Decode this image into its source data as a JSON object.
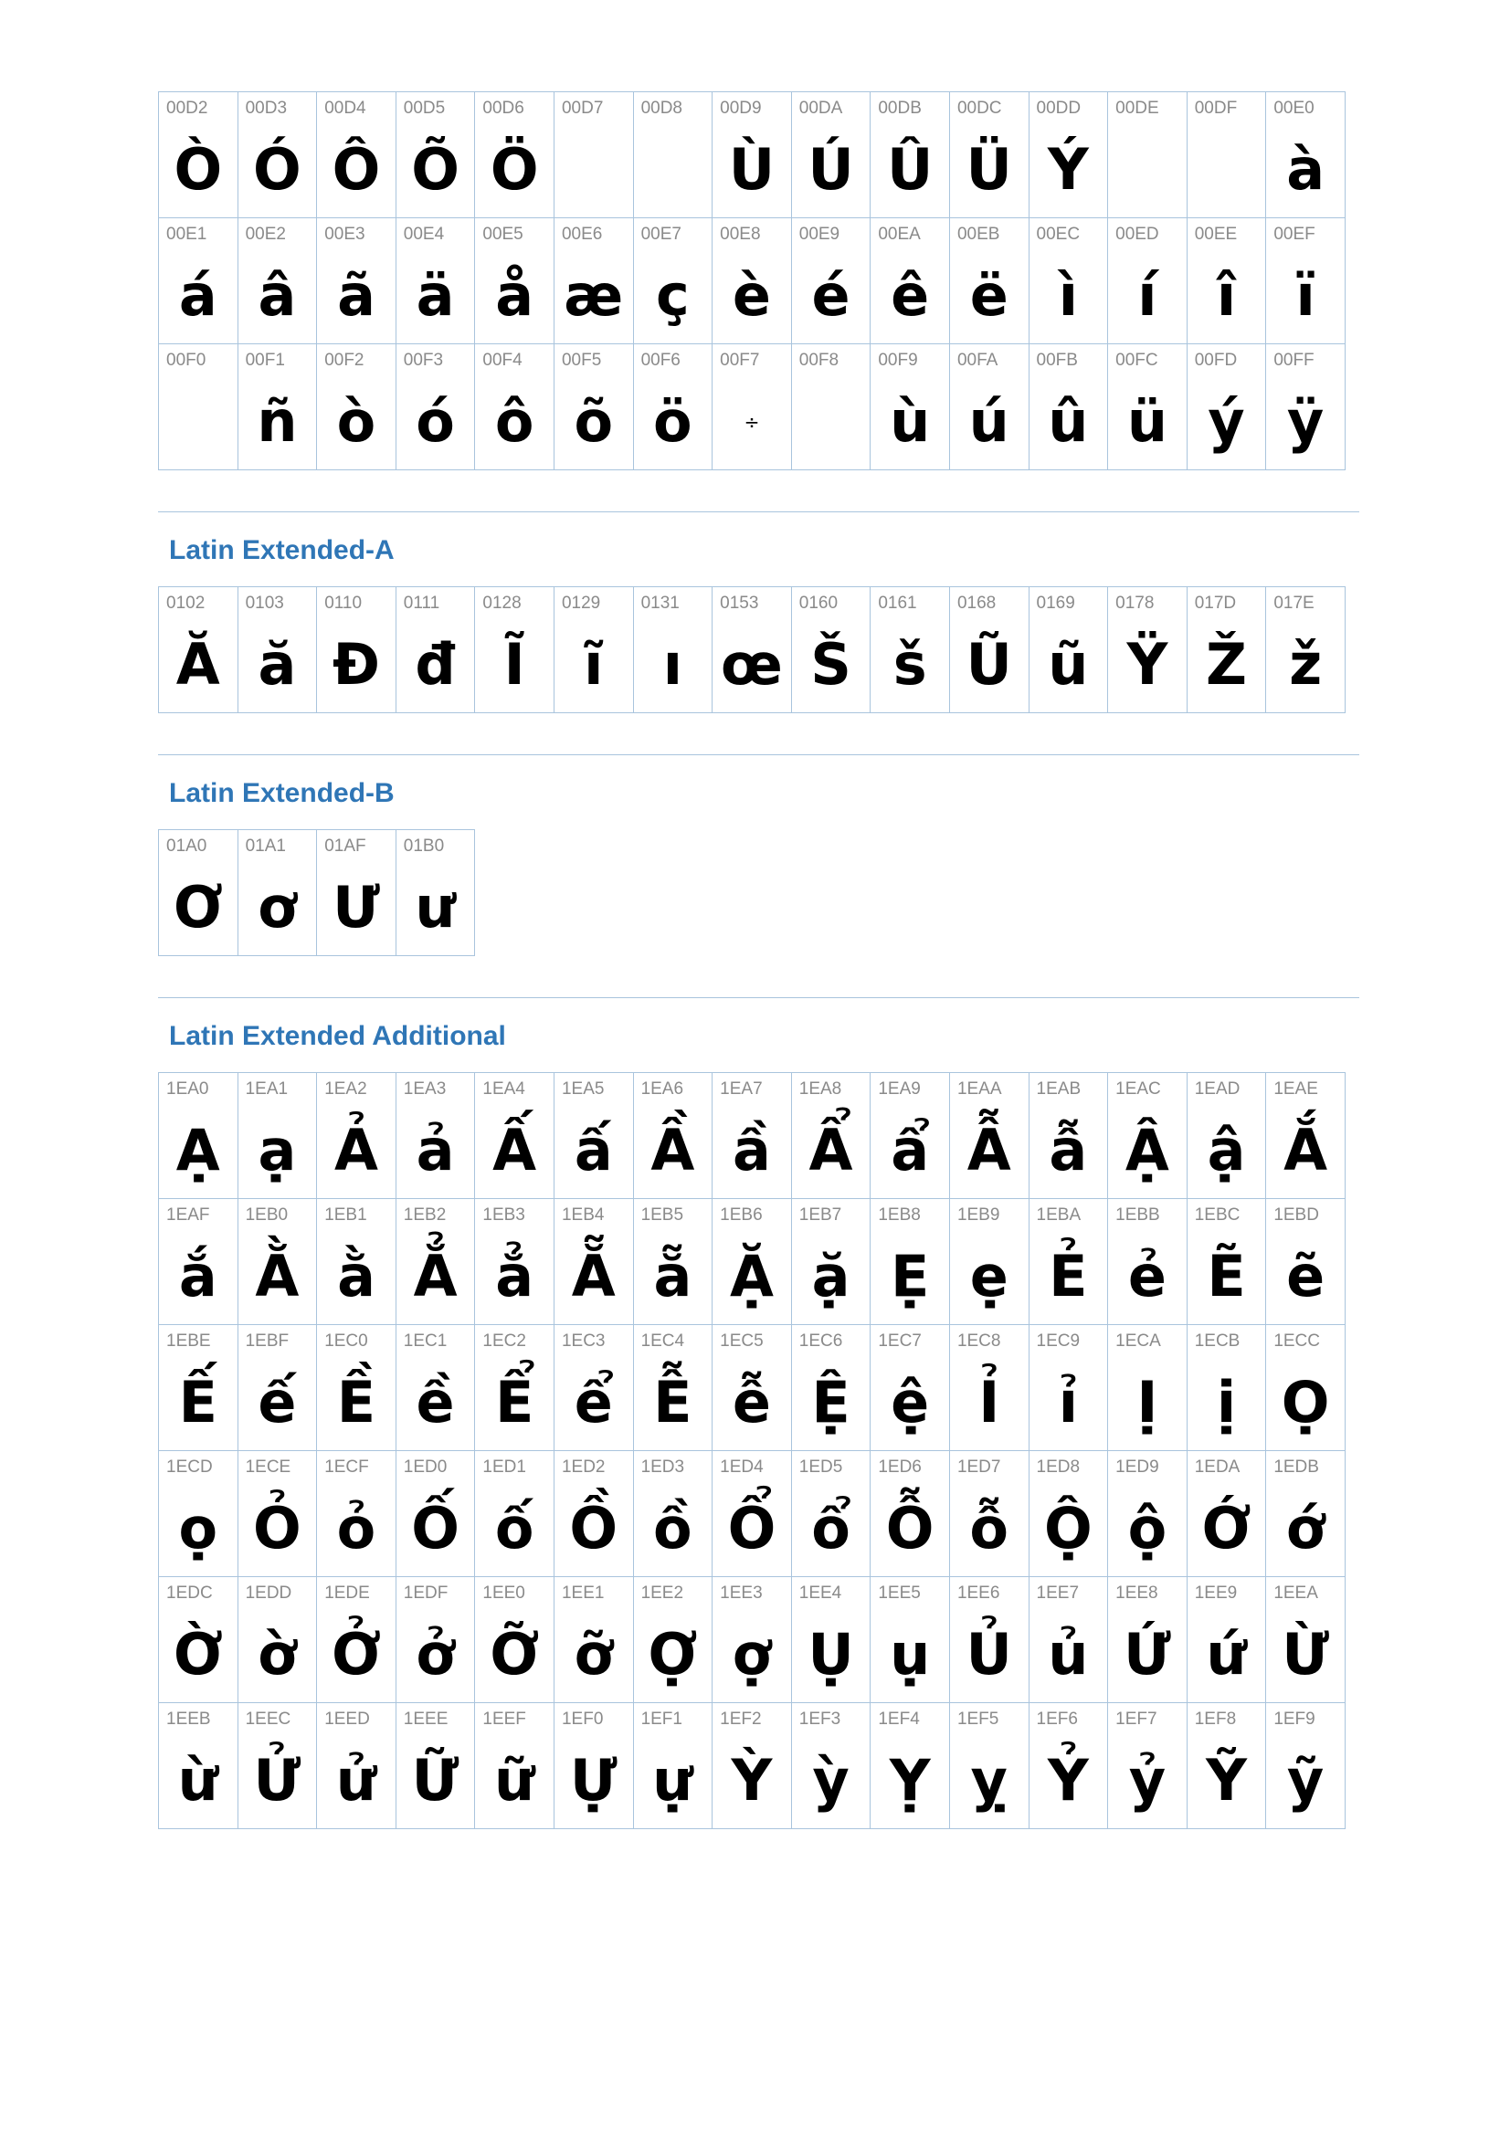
{
  "sections": [
    {
      "heading": "",
      "rows": [
        [
          {
            "code": "00D2",
            "glyph": "Ò"
          },
          {
            "code": "00D3",
            "glyph": "Ó"
          },
          {
            "code": "00D4",
            "glyph": "Ô"
          },
          {
            "code": "00D5",
            "glyph": "Õ"
          },
          {
            "code": "00D6",
            "glyph": "Ö"
          },
          {
            "code": "00D7",
            "glyph": ""
          },
          {
            "code": "00D8",
            "glyph": ""
          },
          {
            "code": "00D9",
            "glyph": "Ù"
          },
          {
            "code": "00DA",
            "glyph": "Ú"
          },
          {
            "code": "00DB",
            "glyph": "Û"
          },
          {
            "code": "00DC",
            "glyph": "Ü"
          },
          {
            "code": "00DD",
            "glyph": "Ý"
          },
          {
            "code": "00DE",
            "glyph": ""
          },
          {
            "code": "00DF",
            "glyph": ""
          },
          {
            "code": "00E0",
            "glyph": "à"
          }
        ],
        [
          {
            "code": "00E1",
            "glyph": "á"
          },
          {
            "code": "00E2",
            "glyph": "â"
          },
          {
            "code": "00E3",
            "glyph": "ã"
          },
          {
            "code": "00E4",
            "glyph": "ä"
          },
          {
            "code": "00E5",
            "glyph": "å"
          },
          {
            "code": "00E6",
            "glyph": "æ"
          },
          {
            "code": "00E7",
            "glyph": "ç"
          },
          {
            "code": "00E8",
            "glyph": "è"
          },
          {
            "code": "00E9",
            "glyph": "é"
          },
          {
            "code": "00EA",
            "glyph": "ê"
          },
          {
            "code": "00EB",
            "glyph": "ë"
          },
          {
            "code": "00EC",
            "glyph": "ì"
          },
          {
            "code": "00ED",
            "glyph": "í"
          },
          {
            "code": "00EE",
            "glyph": "î"
          },
          {
            "code": "00EF",
            "glyph": "ï"
          }
        ],
        [
          {
            "code": "00F0",
            "glyph": ""
          },
          {
            "code": "00F1",
            "glyph": "ñ"
          },
          {
            "code": "00F2",
            "glyph": "ò"
          },
          {
            "code": "00F3",
            "glyph": "ó"
          },
          {
            "code": "00F4",
            "glyph": "ô"
          },
          {
            "code": "00F5",
            "glyph": "õ"
          },
          {
            "code": "00F6",
            "glyph": "ö"
          },
          {
            "code": "00F7",
            "glyph": "÷",
            "small": true
          },
          {
            "code": "00F8",
            "glyph": ""
          },
          {
            "code": "00F9",
            "glyph": "ù"
          },
          {
            "code": "00FA",
            "glyph": "ú"
          },
          {
            "code": "00FB",
            "glyph": "û"
          },
          {
            "code": "00FC",
            "glyph": "ü"
          },
          {
            "code": "00FD",
            "glyph": "ý"
          },
          {
            "code": "00FF",
            "glyph": "ÿ"
          }
        ]
      ]
    },
    {
      "heading": "Latin Extended-A",
      "rows": [
        [
          {
            "code": "0102",
            "glyph": "Ă"
          },
          {
            "code": "0103",
            "glyph": "ă"
          },
          {
            "code": "0110",
            "glyph": "Đ"
          },
          {
            "code": "0111",
            "glyph": "đ"
          },
          {
            "code": "0128",
            "glyph": "Ĩ"
          },
          {
            "code": "0129",
            "glyph": "ĩ"
          },
          {
            "code": "0131",
            "glyph": "ı"
          },
          {
            "code": "0153",
            "glyph": "œ"
          },
          {
            "code": "0160",
            "glyph": "Š"
          },
          {
            "code": "0161",
            "glyph": "š"
          },
          {
            "code": "0168",
            "glyph": "Ũ"
          },
          {
            "code": "0169",
            "glyph": "ũ"
          },
          {
            "code": "0178",
            "glyph": "Ÿ"
          },
          {
            "code": "017D",
            "glyph": "Ž"
          },
          {
            "code": "017E",
            "glyph": "ž"
          }
        ]
      ]
    },
    {
      "heading": "Latin Extended-B",
      "rows": [
        [
          {
            "code": "01A0",
            "glyph": "Ơ"
          },
          {
            "code": "01A1",
            "glyph": "ơ"
          },
          {
            "code": "01AF",
            "glyph": "Ư"
          },
          {
            "code": "01B0",
            "glyph": "ư"
          }
        ]
      ]
    },
    {
      "heading": "Latin Extended Additional",
      "rows": [
        [
          {
            "code": "1EA0",
            "glyph": "Ạ"
          },
          {
            "code": "1EA1",
            "glyph": "ạ"
          },
          {
            "code": "1EA2",
            "glyph": "Ả"
          },
          {
            "code": "1EA3",
            "glyph": "ả"
          },
          {
            "code": "1EA4",
            "glyph": "Ấ"
          },
          {
            "code": "1EA5",
            "glyph": "ấ"
          },
          {
            "code": "1EA6",
            "glyph": "Ầ"
          },
          {
            "code": "1EA7",
            "glyph": "ầ"
          },
          {
            "code": "1EA8",
            "glyph": "Ẩ"
          },
          {
            "code": "1EA9",
            "glyph": "ẩ"
          },
          {
            "code": "1EAA",
            "glyph": "Ẫ"
          },
          {
            "code": "1EAB",
            "glyph": "ẫ"
          },
          {
            "code": "1EAC",
            "glyph": "Ậ"
          },
          {
            "code": "1EAD",
            "glyph": "ậ"
          },
          {
            "code": "1EAE",
            "glyph": "Ắ"
          }
        ],
        [
          {
            "code": "1EAF",
            "glyph": "ắ"
          },
          {
            "code": "1EB0",
            "glyph": "Ằ"
          },
          {
            "code": "1EB1",
            "glyph": "ằ"
          },
          {
            "code": "1EB2",
            "glyph": "Ẳ"
          },
          {
            "code": "1EB3",
            "glyph": "ẳ"
          },
          {
            "code": "1EB4",
            "glyph": "Ẵ"
          },
          {
            "code": "1EB5",
            "glyph": "ẵ"
          },
          {
            "code": "1EB6",
            "glyph": "Ặ"
          },
          {
            "code": "1EB7",
            "glyph": "ặ"
          },
          {
            "code": "1EB8",
            "glyph": "Ẹ"
          },
          {
            "code": "1EB9",
            "glyph": "ẹ"
          },
          {
            "code": "1EBA",
            "glyph": "Ẻ"
          },
          {
            "code": "1EBB",
            "glyph": "ẻ"
          },
          {
            "code": "1EBC",
            "glyph": "Ẽ"
          },
          {
            "code": "1EBD",
            "glyph": "ẽ"
          }
        ],
        [
          {
            "code": "1EBE",
            "glyph": "Ế"
          },
          {
            "code": "1EBF",
            "glyph": "ế"
          },
          {
            "code": "1EC0",
            "glyph": "Ề"
          },
          {
            "code": "1EC1",
            "glyph": "ề"
          },
          {
            "code": "1EC2",
            "glyph": "Ể"
          },
          {
            "code": "1EC3",
            "glyph": "ể"
          },
          {
            "code": "1EC4",
            "glyph": "Ễ"
          },
          {
            "code": "1EC5",
            "glyph": "ễ"
          },
          {
            "code": "1EC6",
            "glyph": "Ệ"
          },
          {
            "code": "1EC7",
            "glyph": "ệ"
          },
          {
            "code": "1EC8",
            "glyph": "Ỉ"
          },
          {
            "code": "1EC9",
            "glyph": "ỉ"
          },
          {
            "code": "1ECA",
            "glyph": "Ị"
          },
          {
            "code": "1ECB",
            "glyph": "ị"
          },
          {
            "code": "1ECC",
            "glyph": "Ọ"
          }
        ],
        [
          {
            "code": "1ECD",
            "glyph": "ọ"
          },
          {
            "code": "1ECE",
            "glyph": "Ỏ"
          },
          {
            "code": "1ECF",
            "glyph": "ỏ"
          },
          {
            "code": "1ED0",
            "glyph": "Ố"
          },
          {
            "code": "1ED1",
            "glyph": "ố"
          },
          {
            "code": "1ED2",
            "glyph": "Ồ"
          },
          {
            "code": "1ED3",
            "glyph": "ồ"
          },
          {
            "code": "1ED4",
            "glyph": "Ổ"
          },
          {
            "code": "1ED5",
            "glyph": "ổ"
          },
          {
            "code": "1ED6",
            "glyph": "Ỗ"
          },
          {
            "code": "1ED7",
            "glyph": "ỗ"
          },
          {
            "code": "1ED8",
            "glyph": "Ộ"
          },
          {
            "code": "1ED9",
            "glyph": "ộ"
          },
          {
            "code": "1EDA",
            "glyph": "Ớ"
          },
          {
            "code": "1EDB",
            "glyph": "ớ"
          }
        ],
        [
          {
            "code": "1EDC",
            "glyph": "Ờ"
          },
          {
            "code": "1EDD",
            "glyph": "ờ"
          },
          {
            "code": "1EDE",
            "glyph": "Ở"
          },
          {
            "code": "1EDF",
            "glyph": "ở"
          },
          {
            "code": "1EE0",
            "glyph": "Ỡ"
          },
          {
            "code": "1EE1",
            "glyph": "ỡ"
          },
          {
            "code": "1EE2",
            "glyph": "Ợ"
          },
          {
            "code": "1EE3",
            "glyph": "ợ"
          },
          {
            "code": "1EE4",
            "glyph": "Ụ"
          },
          {
            "code": "1EE5",
            "glyph": "ụ"
          },
          {
            "code": "1EE6",
            "glyph": "Ủ"
          },
          {
            "code": "1EE7",
            "glyph": "ủ"
          },
          {
            "code": "1EE8",
            "glyph": "Ứ"
          },
          {
            "code": "1EE9",
            "glyph": "ứ"
          },
          {
            "code": "1EEA",
            "glyph": "Ừ"
          }
        ],
        [
          {
            "code": "1EEB",
            "glyph": "ừ"
          },
          {
            "code": "1EEC",
            "glyph": "Ử"
          },
          {
            "code": "1EED",
            "glyph": "ử"
          },
          {
            "code": "1EEE",
            "glyph": "Ữ"
          },
          {
            "code": "1EEF",
            "glyph": "ữ"
          },
          {
            "code": "1EF0",
            "glyph": "Ự"
          },
          {
            "code": "1EF1",
            "glyph": "ự"
          },
          {
            "code": "1EF2",
            "glyph": "Ỳ"
          },
          {
            "code": "1EF3",
            "glyph": "ỳ"
          },
          {
            "code": "1EF4",
            "glyph": "Ỵ"
          },
          {
            "code": "1EF5",
            "glyph": "ỵ"
          },
          {
            "code": "1EF6",
            "glyph": "Ỷ"
          },
          {
            "code": "1EF7",
            "glyph": "ỷ"
          },
          {
            "code": "1EF8",
            "glyph": "Ỹ"
          },
          {
            "code": "1EF9",
            "glyph": "ỹ"
          }
        ]
      ]
    }
  ]
}
